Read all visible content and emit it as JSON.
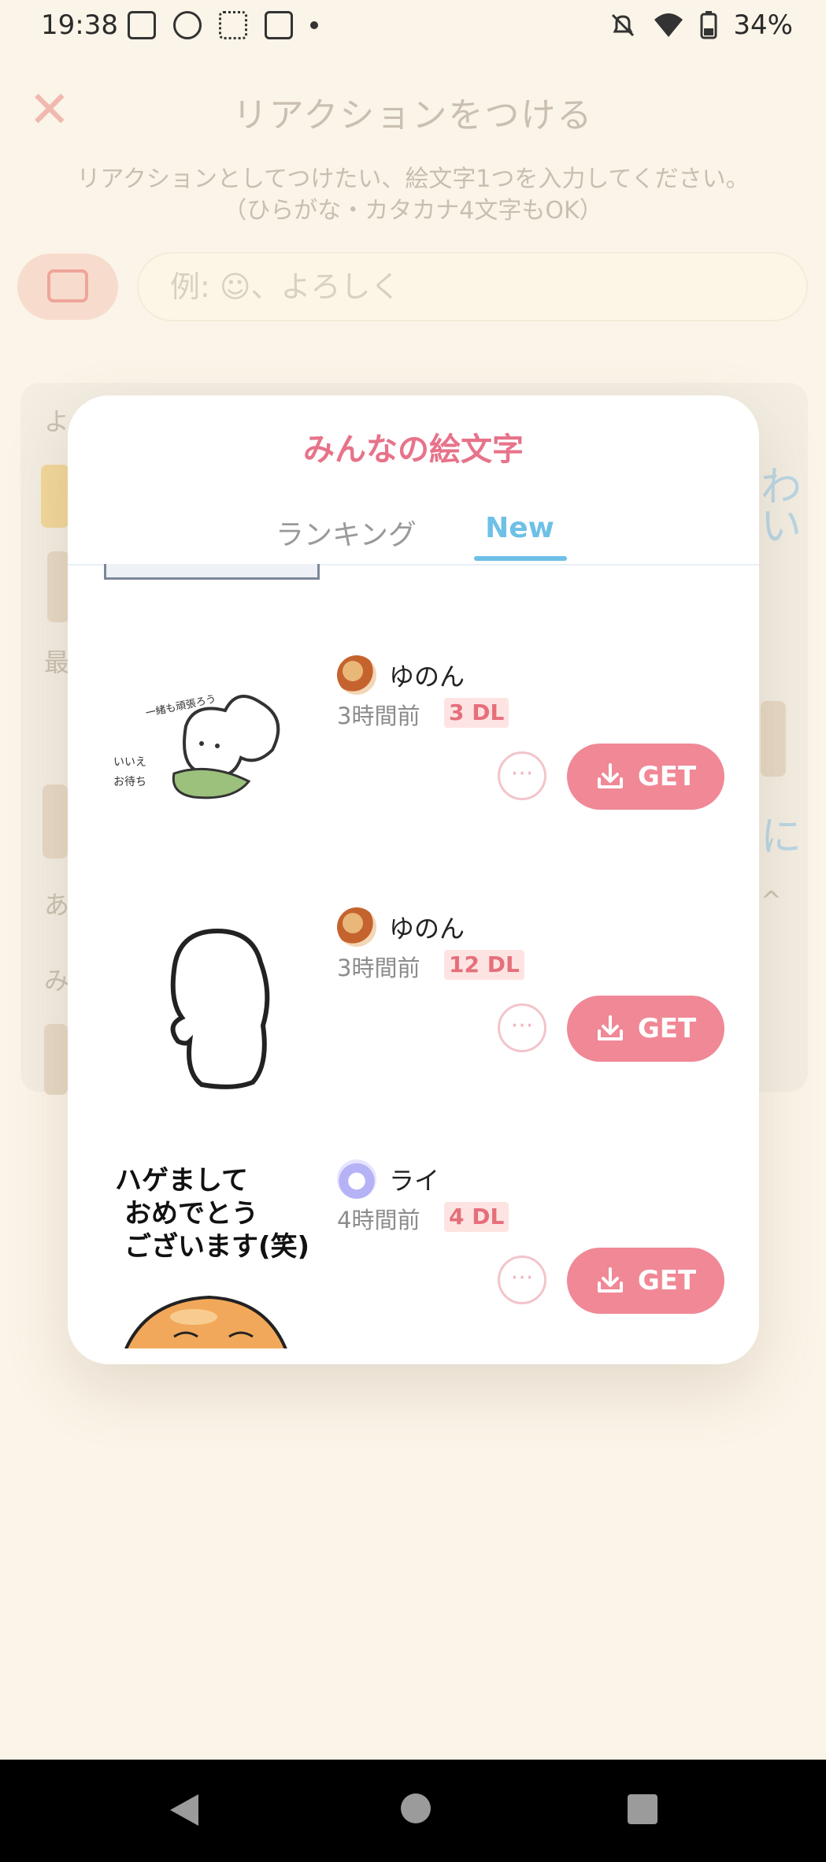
{
  "status_bar": {
    "time": "19:38",
    "battery": "34%",
    "left_icons": [
      "d-icon",
      "info-icon",
      "grid-icon",
      "news-icon"
    ],
    "right_icons": [
      "bell-off-icon",
      "wifi-icon",
      "battery-icon"
    ]
  },
  "background": {
    "title": "リアクションをつける",
    "description_line1": "リアクションとしてつけたい、絵文字1つを入力してください。",
    "description_line2": "（ひらがな・カタカナ4文字もOK）",
    "input_placeholder": "例: ☺、よろしく",
    "fragments": {
      "left_1": "よ",
      "left_2": "最",
      "left_3": "あ",
      "left_4": "み",
      "right_1": "わ",
      "right_2": "い",
      "right_3": "に"
    }
  },
  "modal": {
    "title": "みんなの絵文字",
    "tabs": [
      {
        "label": "ランキング",
        "active": false
      },
      {
        "label": "New",
        "active": true
      }
    ],
    "items": [
      {
        "user": "ゆのん",
        "time": "3時間前",
        "downloads": "3 DL",
        "get_label": "GET",
        "more_label": "···",
        "avatar": "av1"
      },
      {
        "user": "ゆのん",
        "time": "3時間前",
        "downloads": "12 DL",
        "get_label": "GET",
        "more_label": "···",
        "avatar": "av1"
      },
      {
        "user": "ライ",
        "time": "4時間前",
        "downloads": "4 DL",
        "get_label": "GET",
        "more_label": "···",
        "avatar": "av2",
        "sticker_text": [
          "ハゲまして",
          "おめでとう",
          "ございます(笑)"
        ]
      }
    ],
    "sticker1_text": [
      "一緒も頑張ろう",
      "いいえ",
      "お待ち"
    ]
  },
  "colors": {
    "accent_pink": "#e7738a",
    "get_button": "#f08896",
    "tab_active": "#6ec0e6",
    "background": "#fbf4e8"
  }
}
